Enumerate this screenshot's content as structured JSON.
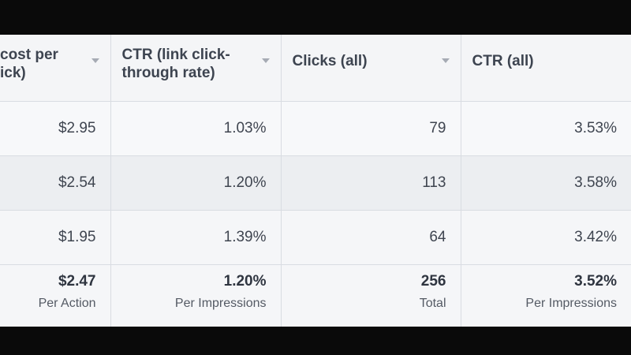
{
  "columns": [
    {
      "label": "cost per\nick)"
    },
    {
      "label": "CTR (link click-\nthrough rate)"
    },
    {
      "label": "Clicks (all)"
    },
    {
      "label": "CTR (all)"
    }
  ],
  "rows": [
    [
      "$2.95",
      "1.03%",
      "79",
      "3.53%"
    ],
    [
      "$2.54",
      "1.20%",
      "113",
      "3.58%"
    ],
    [
      "$1.95",
      "1.39%",
      "64",
      "3.42%"
    ]
  ],
  "summary": [
    {
      "value": "$2.47",
      "caption": "Per Action"
    },
    {
      "value": "1.20%",
      "caption": "Per Impressions"
    },
    {
      "value": "256",
      "caption": "Total"
    },
    {
      "value": "3.52%",
      "caption": "Per Impressions"
    }
  ]
}
